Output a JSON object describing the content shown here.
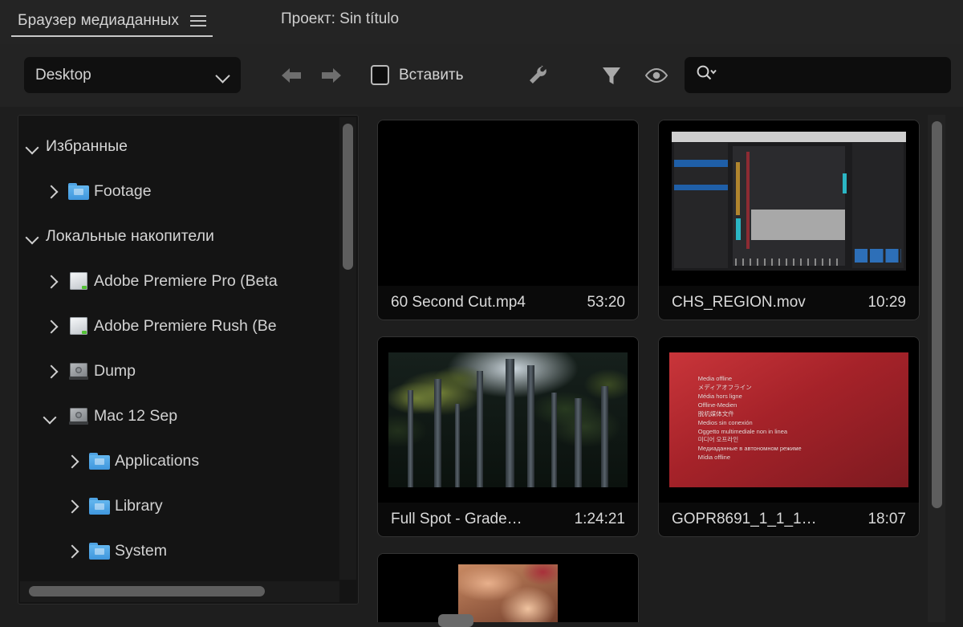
{
  "panel": {
    "tab_label": "Браузер медиаданных",
    "menu_icon": "hamburger-icon",
    "project_title": "Проект: Sin título"
  },
  "toolbar": {
    "location_value": "Desktop",
    "location_chevron_icon": "chevron-down-icon",
    "back_icon": "arrow-left-icon",
    "forward_icon": "arrow-right-icon",
    "insert_label": "Вставить",
    "insert_icon": "insert-square-icon",
    "wrench_icon": "wrench-icon",
    "filter_icon": "filter-funnel-icon",
    "eye_icon": "eye-icon",
    "search_icon": "search-icon",
    "search_value": "",
    "search_placeholder": ""
  },
  "sidebar": {
    "items": [
      {
        "label": "Избранные",
        "icon": "none",
        "twisty": "open",
        "indent": 0
      },
      {
        "label": "Footage",
        "icon": "folder-blue",
        "twisty": "closed",
        "indent": 1
      },
      {
        "label": "Локальные накопители",
        "icon": "none",
        "twisty": "open",
        "indent": 0
      },
      {
        "label": "Adobe Premiere Pro (Beta",
        "icon": "drive-external",
        "twisty": "closed",
        "indent": 1
      },
      {
        "label": "Adobe Premiere Rush (Be",
        "icon": "drive-external",
        "twisty": "closed",
        "indent": 1
      },
      {
        "label": "Dump",
        "icon": "hard-disk",
        "twisty": "closed",
        "indent": 1
      },
      {
        "label": "Mac 12 Sep",
        "icon": "hard-disk",
        "twisty": "open",
        "indent": 1
      },
      {
        "label": "Applications",
        "icon": "folder-blue",
        "twisty": "closed",
        "indent": 2
      },
      {
        "label": "Library",
        "icon": "folder-blue",
        "twisty": "closed",
        "indent": 2
      },
      {
        "label": "System",
        "icon": "folder-blue",
        "twisty": "closed",
        "indent": 2
      }
    ]
  },
  "grid": {
    "items": [
      {
        "name": "60 Second Cut.mp4",
        "duration": "53:20",
        "pic": "black"
      },
      {
        "name": "CHS_REGION.mov",
        "duration": "10:29",
        "pic": "app-screenshot"
      },
      {
        "name": "Full Spot - Grade…",
        "duration": "1:24:21",
        "pic": "forest"
      },
      {
        "name": "GOPR8691_1_1_1…",
        "duration": "18:07",
        "pic": "media-offline"
      }
    ],
    "offline_card_lines": [
      "Media offline",
      "メディアオフライン",
      "Média hors ligne",
      "Offline-Medien",
      "脱机媒体文件",
      "Medios sin conexión",
      "Oggetto multimediale non in linea",
      "미디어 오프라인",
      "Медиаданные в автономном режиме",
      "Mídia offline"
    ]
  },
  "colors": {
    "app_background": "#1e1e1e",
    "panel_background": "#141414",
    "accent_folder": "#4ea3e3",
    "tab_underline": "#c9c9c9",
    "scrollbar_thumb": "#5e5e5e",
    "offline_red": "#a52229",
    "drive_led_green": "#52c234"
  }
}
